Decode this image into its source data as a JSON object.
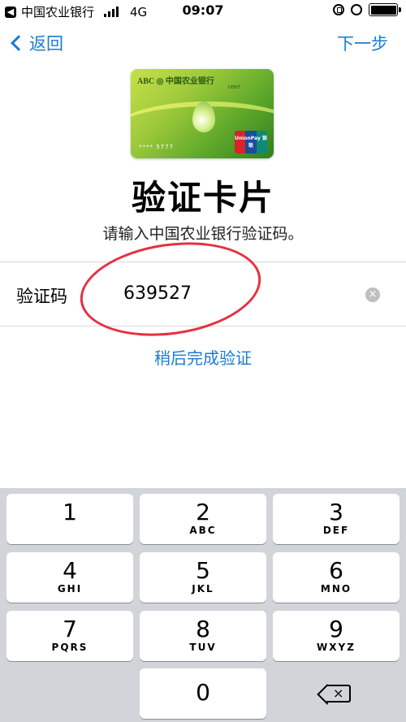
{
  "status_bar": {
    "back_app_glyph": "◀",
    "carrier": "中国农业银行",
    "network": "4G",
    "time": "09:07",
    "battery_level": 1.0
  },
  "nav": {
    "back_label": "返回",
    "next_label": "下一步"
  },
  "card": {
    "logo_text": "ABC ◎ 中国农业银行",
    "type_text": "DEBIT",
    "number_masked": "**** 5777",
    "network_label": "UnionPay 银联"
  },
  "page": {
    "title": "验证卡片",
    "subtitle": "请输入中国农业银行验证码。"
  },
  "verify_field": {
    "label": "验证码",
    "value": "639527",
    "clear_glyph": "×"
  },
  "later_link": "稍后完成验证",
  "keypad": {
    "keys": [
      {
        "num": "1",
        "letters": ""
      },
      {
        "num": "2",
        "letters": "ABC"
      },
      {
        "num": "3",
        "letters": "DEF"
      },
      {
        "num": "4",
        "letters": "GHI"
      },
      {
        "num": "5",
        "letters": "JKL"
      },
      {
        "num": "6",
        "letters": "MNO"
      },
      {
        "num": "7",
        "letters": "PQRS"
      },
      {
        "num": "8",
        "letters": "TUV"
      },
      {
        "num": "9",
        "letters": "WXYZ"
      },
      {
        "num": "0",
        "letters": ""
      }
    ],
    "delete_glyph": "×"
  },
  "colors": {
    "accent": "#1a7bd4",
    "annotation": "#e53140",
    "keypad_bg": "#d1d4d9"
  }
}
